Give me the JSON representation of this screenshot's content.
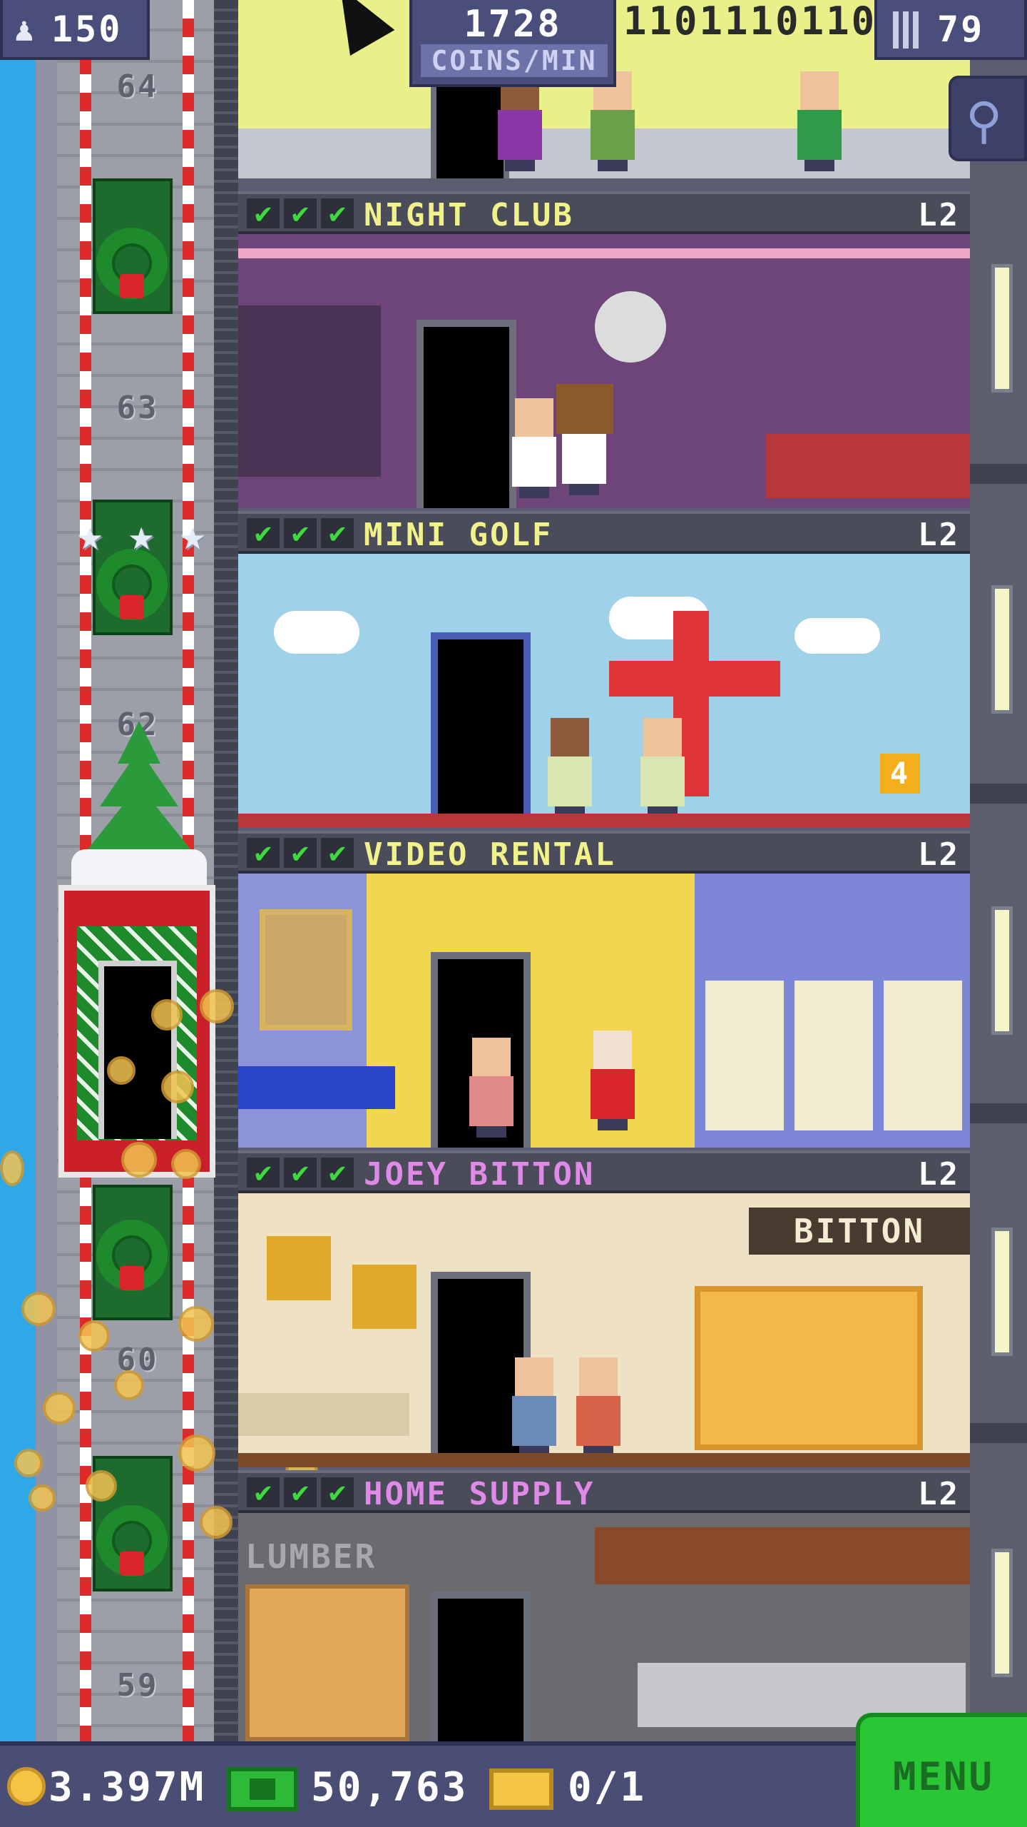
{
  "hud": {
    "population": "150",
    "coins_per_min_value": "1728",
    "coins_per_min_label": "COINS/MIN",
    "binary_ticker": "1101110110",
    "floor_count": "79"
  },
  "elevator": {
    "floor_numbers": [
      "64",
      "63",
      "62",
      "60",
      "59"
    ]
  },
  "floors": [
    {
      "name": "NIGHT CLUB",
      "level": "L2",
      "checks": 3,
      "name_color": "#f2f28a"
    },
    {
      "name": "MINI GOLF",
      "level": "L2",
      "checks": 3,
      "name_color": "#f2f28a"
    },
    {
      "name": "VIDEO RENTAL",
      "level": "L2",
      "checks": 3,
      "name_color": "#f2f28a"
    },
    {
      "name": "JOEY BITTON",
      "level": "L2",
      "checks": 3,
      "name_color": "#e08ae8",
      "sign": "BITTON"
    },
    {
      "name": "HOME SUPPLY",
      "level": "L2",
      "checks": 3,
      "name_color": "#e08ae8",
      "sign": "LUMBER"
    }
  ],
  "golf_hole_number": "4",
  "bottom": {
    "coins": "3.397M",
    "tower_bux": "50,763",
    "tickets": "0/1",
    "menu_label": "MENU"
  },
  "colors": {
    "hud_bg": "#4a4e7a",
    "menu_green": "#29c636",
    "commercial_yellow": "#f2f28a",
    "retail_pink": "#e08ae8"
  }
}
